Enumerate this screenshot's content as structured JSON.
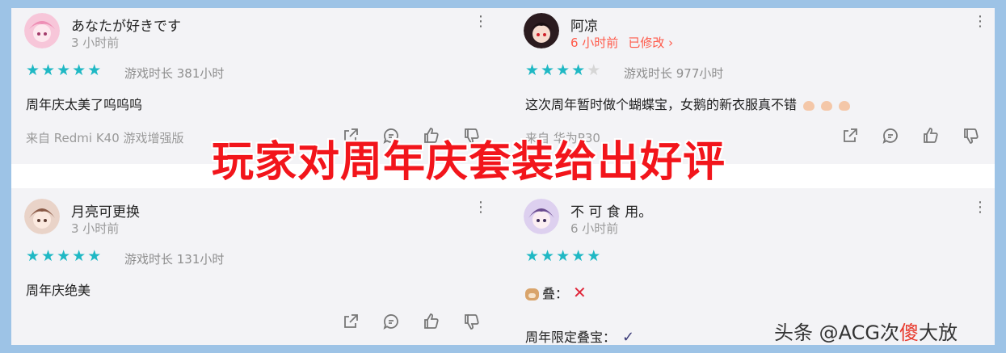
{
  "overlay_title": "玩家对周年庆套装给出好评",
  "watermark": {
    "prefix": "头条 @ACG次",
    "highlight": "傻",
    "suffix": "大放"
  },
  "colors": {
    "star_active": "#1fb8c4",
    "star_inactive": "#d6d6d6",
    "edited": "#ff5a4a",
    "title": "#f2151b",
    "panel": "#f3f3f6"
  },
  "reviews": [
    {
      "username": "あなたが好きです",
      "time": "3 小时前",
      "rating": 5,
      "playtime": "游戏时长 381小时",
      "text": "周年庆太美了呜呜呜",
      "device": "来自 Redmi K40 游戏增强版",
      "avatar_icon": "pink-hair-avatar"
    },
    {
      "username": "阿凉",
      "time": "6 小时前",
      "edited": "已修改 ›",
      "rating": 4,
      "playtime": "游戏时长 977小时",
      "text": "这次周年暂时做个蝴蝶宝，女鹅的新衣服真不错",
      "device": "来自 华为P30",
      "avatar_icon": "red-eyed-avatar"
    },
    {
      "username": "月亮可更换",
      "time": "3 小时前",
      "rating": 5,
      "playtime": "游戏时长 131小时",
      "text": "周年庆绝美",
      "avatar_icon": "brown-hair-avatar"
    },
    {
      "username": "不 可 食 用。",
      "time": "6 小时前",
      "rating": 5,
      "line1": "叠：",
      "line2": "周年限定叠宝：",
      "avatar_icon": "purple-hair-avatar"
    }
  ]
}
